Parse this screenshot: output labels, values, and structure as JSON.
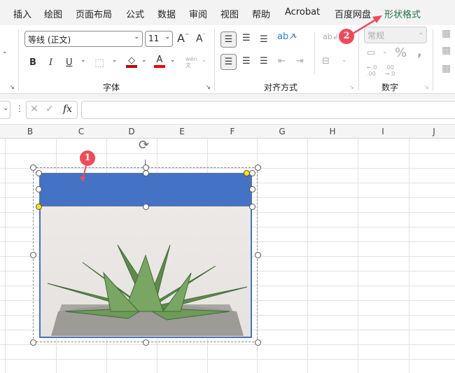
{
  "tabs": [
    "插入",
    "绘图",
    "页面布局",
    "公式",
    "数据",
    "审阅",
    "视图",
    "帮助",
    "Acrobat",
    "百度网盘",
    "形状格式"
  ],
  "font": {
    "name": "等线 (正文)",
    "size": "11",
    "group_label": "字体"
  },
  "alignment": {
    "group_label": "对齐方式"
  },
  "number": {
    "format": "常规",
    "group_label": "数字"
  },
  "formula": {
    "fx": "fx",
    "value": ""
  },
  "columns": [
    "B",
    "C",
    "D",
    "E",
    "F",
    "G",
    "H",
    "I",
    "J"
  ],
  "annotations": [
    "1",
    "2"
  ],
  "colors": {
    "accent": "#4472c4",
    "active_tab": "#1e7145",
    "badge": "#f04a5a"
  }
}
